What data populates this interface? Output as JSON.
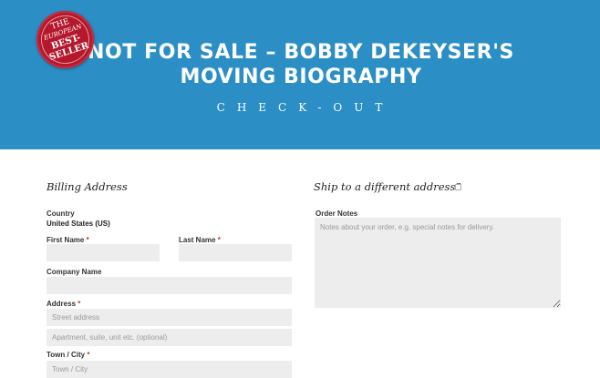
{
  "hero": {
    "title": "NOT FOR SALE – BOBBY DEKEYSER'S MOVING BIOGRAPHY",
    "subtitle": "CHECK-OUT",
    "seal": {
      "line1": "THE",
      "line2": "EUROPEAN",
      "line3": "BEST-",
      "line4": "SELLER"
    },
    "colors": {
      "hero_bg": "#2b8fc6",
      "seal_bg": "#b5182c"
    }
  },
  "billing": {
    "heading": "Billing Address",
    "country_label": "Country",
    "country_value": "United States (US)",
    "first_name_label": "First Name",
    "last_name_label": "Last Name",
    "company_label": "Company Name",
    "address_label": "Address",
    "street_placeholder": "Street address",
    "apartment_placeholder": "Apartment, suite, unit etc. (optional)",
    "city_label": "Town / City",
    "city_placeholder": "Town / City",
    "required_mark": "*"
  },
  "shipping": {
    "heading": "Ship to a different address?",
    "order_notes_label": "Order Notes",
    "order_notes_placeholder": "Notes about your order, e.g. special notes for delivery."
  }
}
